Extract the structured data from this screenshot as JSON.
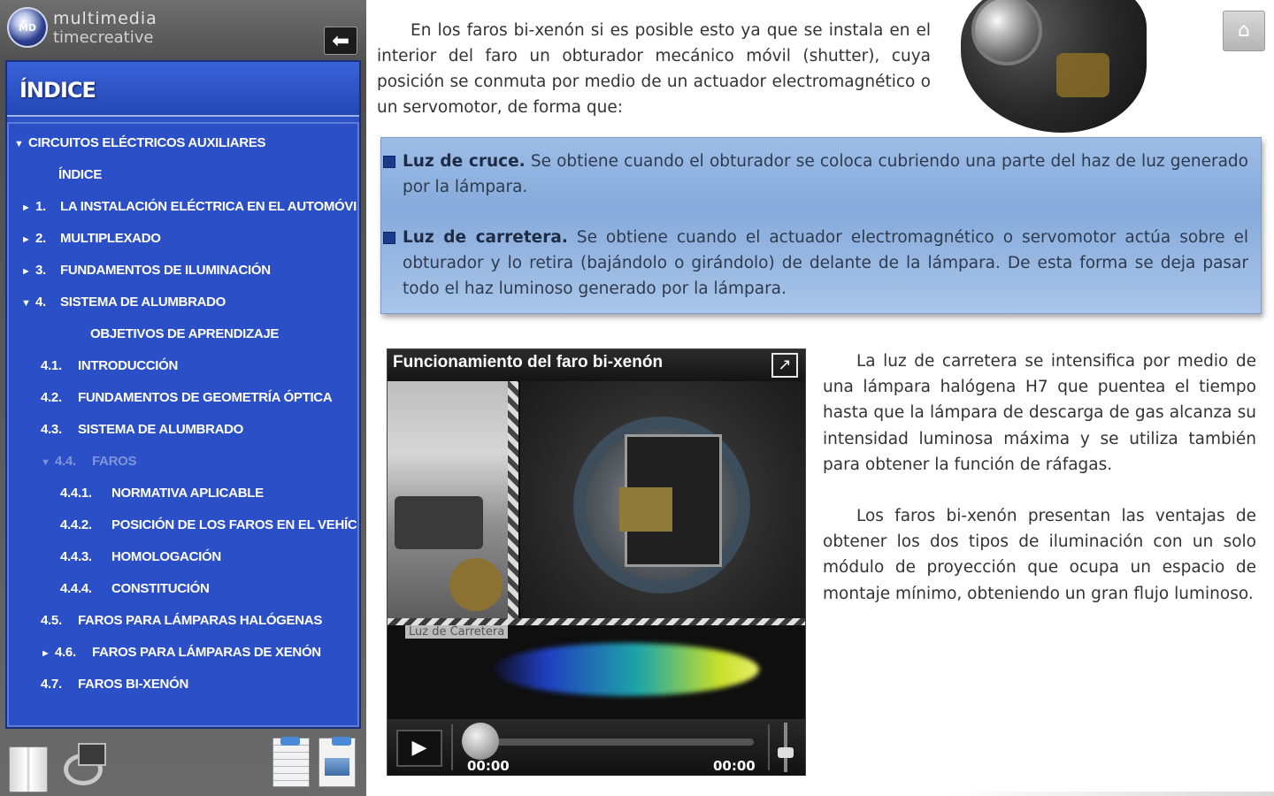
{
  "brand": {
    "logo_text": "MD",
    "line1": "multimedia",
    "line2": "timecreative"
  },
  "sidebar": {
    "back_icon": "arrow-left-icon",
    "index_title": "ÍNDICE",
    "items": [
      {
        "arrow": "▼",
        "num": "",
        "label": "CIRCUITOS ELÉCTRICOS AUXILIARES"
      },
      {
        "arrow": "",
        "num": "",
        "label": "ÍNDICE"
      },
      {
        "arrow": "►",
        "num": "1.",
        "label": "LA INSTALACIÓN ELÉCTRICA EN EL AUTOMÓVIL"
      },
      {
        "arrow": "►",
        "num": "2.",
        "label": "MULTIPLEXADO"
      },
      {
        "arrow": "►",
        "num": "3.",
        "label": "FUNDAMENTOS DE ILUMINACIÓN"
      },
      {
        "arrow": "▼",
        "num": "4.",
        "label": "SISTEMA DE ALUMBRADO"
      },
      {
        "arrow": "",
        "num": "",
        "label": "OBJETIVOS DE APRENDIZAJE"
      },
      {
        "arrow": "",
        "num": "4.1.",
        "label": "INTRODUCCIÓN"
      },
      {
        "arrow": "",
        "num": "4.2.",
        "label": "FUNDAMENTOS DE GEOMETRÍA ÓPTICA"
      },
      {
        "arrow": "",
        "num": "4.3.",
        "label": "SISTEMA DE ALUMBRADO"
      },
      {
        "arrow": "▼",
        "num": "4.4.",
        "label": "FAROS"
      },
      {
        "arrow": "",
        "num": "4.4.1.",
        "label": "NORMATIVA APLICABLE"
      },
      {
        "arrow": "",
        "num": "4.4.2.",
        "label": "POSICIÓN DE LOS FAROS EN EL VEHÍCULO"
      },
      {
        "arrow": "",
        "num": "4.4.3.",
        "label": "HOMOLOGACIÓN"
      },
      {
        "arrow": "",
        "num": "4.4.4.",
        "label": "CONSTITUCIÓN"
      },
      {
        "arrow": "",
        "num": "4.5.",
        "label": "FAROS PARA LÁMPARAS HALÓGENAS"
      },
      {
        "arrow": "►",
        "num": "4.6.",
        "label": "FAROS PARA LÁMPARAS DE XENÓN"
      },
      {
        "arrow": "",
        "num": "4.7.",
        "label": "FAROS BI-XENÓN"
      }
    ]
  },
  "toolbar": {
    "icons": [
      "book-icon",
      "media-gallery-icon",
      "document-icon",
      "image-document-icon"
    ]
  },
  "main": {
    "home_icon": "home-icon",
    "intro": "En los faros bi-xenón si es posible esto ya que se instala en el interior del faro un obturador mecánico móvil (shutter), cuya posición se conmuta por medio de un actuador electromagnético o un servomotor, de forma que:",
    "beams": [
      {
        "term": "Luz de cruce.",
        "text": " Se obtiene cuando el obturador se coloca cubriendo una parte del haz de luz generado por la lámpara."
      },
      {
        "term": "Luz de carretera.",
        "text": " Se obtiene cuando el actuador electromagnético o servomotor actúa sobre el obturador y lo retira (bajándolo o girándolo) de delante de la lámpara. De esta forma se deja pasar todo el haz luminoso generado por la lámpara."
      }
    ],
    "video": {
      "title": "Funcionamiento del faro bi-xenón",
      "frame_caption": "Luz de Carretera",
      "current_time": "00:00",
      "total_time": "00:00",
      "play_icon": "play-icon",
      "expand_icon": "expand-icon"
    },
    "side_paragraphs": [
      "La luz de carretera se intensifica por medio de una lámpara halógena H7 que puentea el tiempo hasta que la lámpara de descarga de gas alcanza su intensidad luminosa máxima y se utiliza también para obtener la función de ráfagas.",
      "Los faros bi-xenón presentan las ventajas de obtener los dos tipos de iluminación con un solo módulo de proyección que ocupa un espacio de montaje mínimo, obteniendo un gran flujo luminoso."
    ]
  },
  "colors": {
    "index_bg": "#2b4fc6",
    "beam_box": "#9dbde6",
    "dim_item": "#7f95d8"
  }
}
